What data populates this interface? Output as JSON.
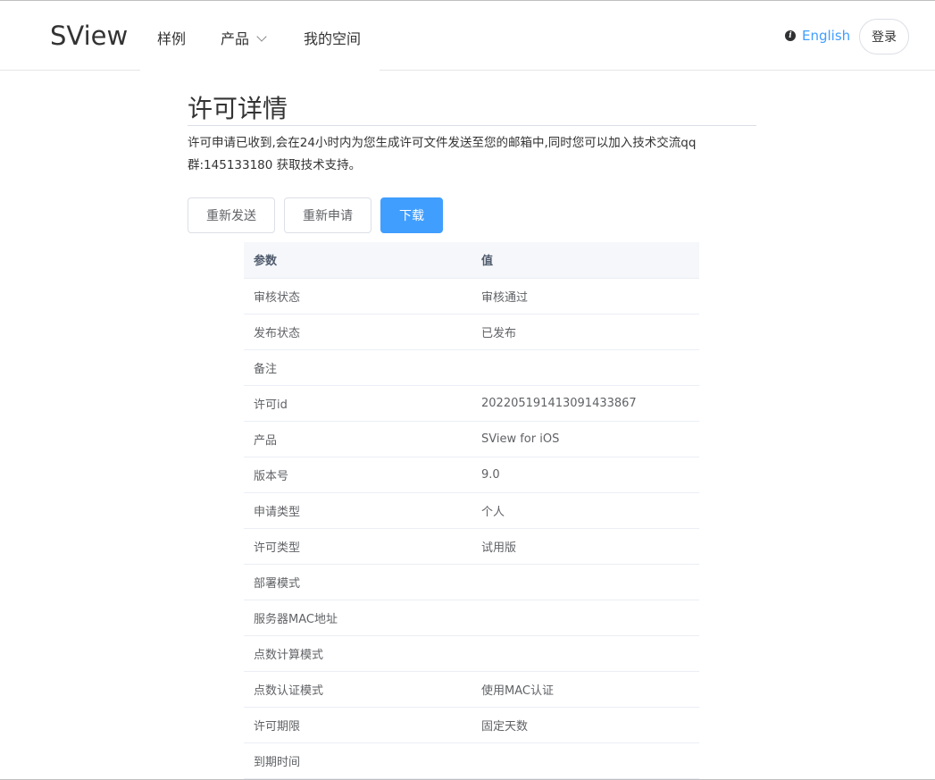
{
  "header": {
    "logo": "SView",
    "nav": {
      "samples": "样例",
      "products": "产品",
      "my_space": "我的空间"
    },
    "language": "English",
    "login": "登录"
  },
  "main": {
    "title": "许可详情",
    "notice": "许可申请已收到,会在24小时内为您生成许可文件发送至您的邮箱中,同时您可以加入技术交流qq群:145133180 获取技术支持。",
    "buttons": {
      "resend": "重新发送",
      "reapply": "重新申请",
      "download": "下载"
    },
    "table": {
      "headers": [
        "参数",
        "值"
      ],
      "rows": [
        {
          "key": "审核状态",
          "value": "审核通过"
        },
        {
          "key": "发布状态",
          "value": "已发布"
        },
        {
          "key": "备注",
          "value": ""
        },
        {
          "key": "许可id",
          "value": "20220519141309143386​7"
        },
        {
          "key": "产品",
          "value": "SView for iOS"
        },
        {
          "key": "版本号",
          "value": "9.0"
        },
        {
          "key": "申请类型",
          "value": "个人"
        },
        {
          "key": "许可类型",
          "value": "试用版"
        },
        {
          "key": "部署模式",
          "value": ""
        },
        {
          "key": "服务器MAC地址",
          "value": ""
        },
        {
          "key": "点数计算模式",
          "value": ""
        },
        {
          "key": "点数认证模式",
          "value": "使用MAC认证"
        },
        {
          "key": "许可期限",
          "value": "固定天数"
        },
        {
          "key": "到期时间",
          "value": ""
        }
      ]
    }
  },
  "colors": {
    "primary": "#409eff",
    "header_row_bg": "#f5f7fa",
    "border": "#ebeef5"
  }
}
